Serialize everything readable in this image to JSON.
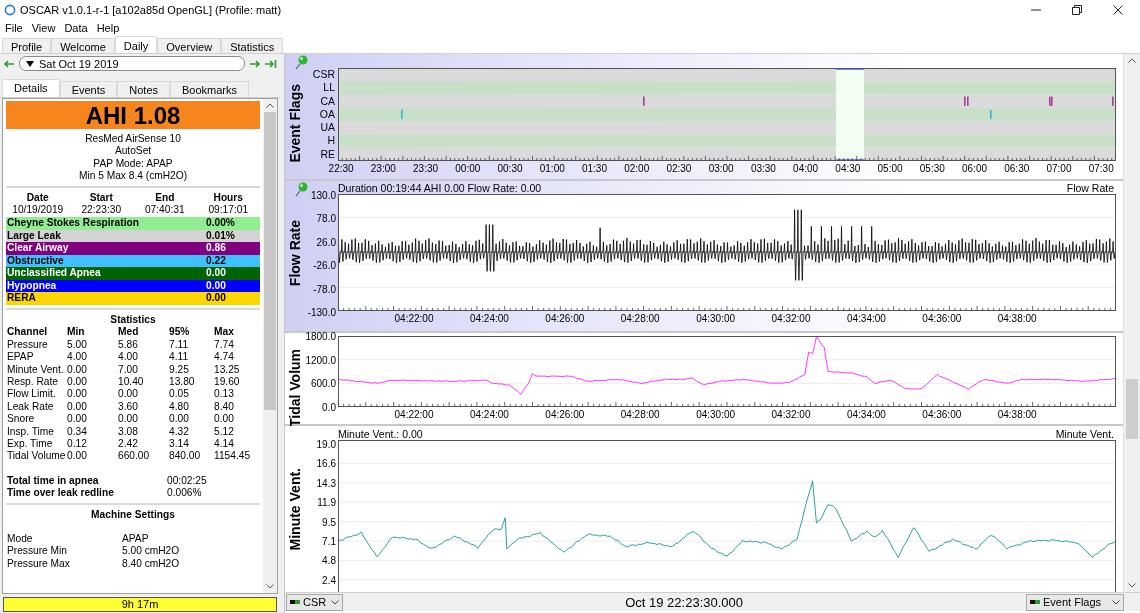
{
  "window": {
    "title": "OSCAR v1.0.1-r-1 [a102a85d OpenGL] (Profile: matt)"
  },
  "menu": [
    "File",
    "View",
    "Data",
    "Help"
  ],
  "tabs": [
    {
      "label": "Profile",
      "selected": false
    },
    {
      "label": "Welcome",
      "selected": false
    },
    {
      "label": "Daily",
      "selected": true
    },
    {
      "label": "Overview",
      "selected": false
    },
    {
      "label": "Statistics",
      "selected": false
    }
  ],
  "date_nav": {
    "date": "Sat Oct 19 2019"
  },
  "detail_tabs": [
    {
      "label": "Details",
      "selected": true
    },
    {
      "label": "Events",
      "selected": false
    },
    {
      "label": "Notes",
      "selected": false
    },
    {
      "label": "Bookmarks",
      "selected": false
    }
  ],
  "details": {
    "ahi": "AHI 1.08",
    "device": [
      "ResMed AirSense 10",
      "AutoSet",
      "PAP Mode: APAP",
      "Min 5 Max 8.4 (cmH2O)"
    ],
    "session": {
      "columns": [
        "Date",
        "Start",
        "End",
        "Hours"
      ],
      "values": [
        "10/19/2019",
        "22:23:30",
        "07:40:31",
        "09:17:01"
      ]
    },
    "events": [
      {
        "name": "Cheyne Stokes Respiration",
        "value": "0.00%",
        "color": "#90ee90"
      },
      {
        "name": "Large Leak",
        "value": "0.01%",
        "color": "#d3d3d3"
      },
      {
        "name": "Clear Airway",
        "value": "0.86",
        "color": "#800080"
      },
      {
        "name": "Obstructive",
        "value": "0.22",
        "color": "#40c0ff"
      },
      {
        "name": "Unclassified Apnea",
        "value": "0.00",
        "color": "#006400"
      },
      {
        "name": "Hypopnea",
        "value": "0.00",
        "color": "#0000ff"
      },
      {
        "name": "RERA",
        "value": "0.00",
        "color": "#ffd700"
      }
    ],
    "statistics": {
      "title": "Statistics",
      "columns": [
        "Channel",
        "Min",
        "Med",
        "95%",
        "Max"
      ],
      "rows": [
        [
          "Pressure",
          "5.00",
          "5.86",
          "7.11",
          "7.74"
        ],
        [
          "EPAP",
          "4.00",
          "4.00",
          "4.11",
          "4.74"
        ],
        [
          "Minute Vent.",
          "0.00",
          "7.00",
          "9.25",
          "13.25"
        ],
        [
          "Resp. Rate",
          "0.00",
          "10.40",
          "13.80",
          "19.60"
        ],
        [
          "Flow Limit.",
          "0.00",
          "0.00",
          "0.05",
          "0.13"
        ],
        [
          "Leak Rate",
          "0.00",
          "3.60",
          "4.80",
          "8.40"
        ],
        [
          "Snore",
          "0.00",
          "0.00",
          "0.00",
          "0.00"
        ],
        [
          "Insp. Time",
          "0.34",
          "3.08",
          "4.32",
          "5.12"
        ],
        [
          "Exp. Time",
          "0.12",
          "2.42",
          "3.14",
          "4.14"
        ],
        [
          "Tidal Volume",
          "0.00",
          "660.00",
          "840.00",
          "1154.45"
        ]
      ]
    },
    "totals": [
      {
        "label": "Total time in apnea",
        "value": "00:02:25"
      },
      {
        "label": "Time over leak redline",
        "value": "0.006%"
      }
    ],
    "machine_settings": {
      "title": "Machine Settings",
      "rows": [
        {
          "label": "Mode",
          "value": "APAP"
        },
        {
          "label": "Pressure Min",
          "value": "5.00 cmH2O"
        },
        {
          "label": "Pressure Max",
          "value": "8.40 cmH2O"
        }
      ]
    }
  },
  "duration_bar": {
    "text": "9h 17m"
  },
  "graphs": {
    "event_flags": {
      "title": "Event Flags",
      "rows": [
        "CSR",
        "LL",
        "CA",
        "OA",
        "UA",
        "H",
        "RE"
      ],
      "x_ticks": [
        "22:30",
        "23:00",
        "23:30",
        "00:00",
        "00:30",
        "01:00",
        "01:30",
        "02:00",
        "02:30",
        "03:00",
        "03:30",
        "04:00",
        "04:30",
        "05:00",
        "05:30",
        "06:00",
        "06:30",
        "07:00",
        "07:30"
      ]
    },
    "flow_rate": {
      "title": "Flow Rate",
      "info": "Duration 00:19:44 AHI 0.00 Flow Rate: 0.00",
      "legend": "Flow Rate",
      "y_ticks": [
        "130.0",
        "78.0",
        "26.0",
        "-26.0",
        "-78.0",
        "-130.0"
      ],
      "x_ticks": [
        "04:22:00",
        "04:24:00",
        "04:26:00",
        "04:28:00",
        "04:30:00",
        "04:32:00",
        "04:34:00",
        "04:36:00",
        "04:38:00"
      ]
    },
    "tidal_volume": {
      "title": "Tidal Volum",
      "y_ticks": [
        "1800.0",
        "1200.0",
        "600.0",
        "0.0"
      ],
      "x_ticks": [
        "04:22:00",
        "04:24:00",
        "04:26:00",
        "04:28:00",
        "04:30:00",
        "04:32:00",
        "04:34:00",
        "04:36:00",
        "04:38:00"
      ]
    },
    "minute_vent": {
      "title": "Minute Vent.",
      "info": "Minute Vent.: 0.00",
      "legend": "Minute Vent.",
      "y_ticks": [
        "19.0",
        "16.6",
        "14.3",
        "11.9",
        "9.5",
        "7.1",
        "4.8",
        "2.4"
      ]
    }
  },
  "status_bar": {
    "channel": "CSR",
    "time": "Oct 19 22:23:30.000",
    "layer": "Event Flags"
  }
}
